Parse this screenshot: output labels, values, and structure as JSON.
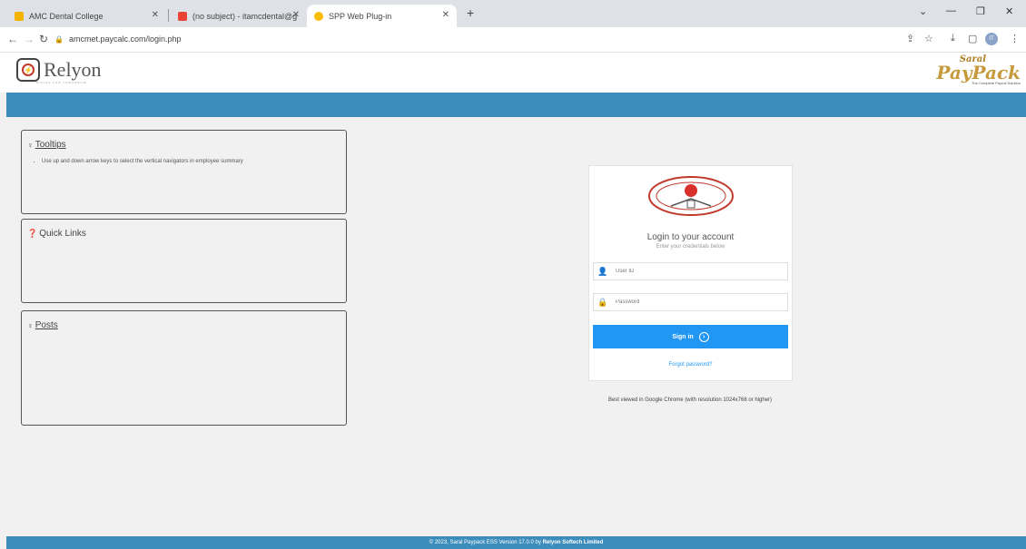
{
  "browser": {
    "tabs": [
      {
        "title": "AMC Dental College",
        "color": "#f4b400"
      },
      {
        "title": "(no subject) - itamcdental@gm",
        "color": "#ea4335"
      },
      {
        "title": "SPP Web Plug-in",
        "color": "#fbbc05"
      }
    ],
    "url": "amcmet.paycalc.com/login.php",
    "profile_initials": "IT"
  },
  "header": {
    "relyon_name": "Relyon",
    "relyon_tagline": "RISING FOR TOMORROW",
    "paypack_prefix": "Saral",
    "paypack_name": "PayPack",
    "paypack_tagline": "The Complete Payroll Solution"
  },
  "panels": {
    "tooltips": {
      "title": "Tooltips",
      "items": [
        "Use up and down arrow keys to select the vertical navigators in employee summary"
      ]
    },
    "quick_links": {
      "title": "Quick Links"
    },
    "posts": {
      "title": "Posts"
    }
  },
  "login": {
    "title": "Login to your account",
    "subtitle": "Enter your credentials below",
    "user_placeholder": "User ID",
    "password_placeholder": "Password",
    "signin_label": "Sign in",
    "forgot_label": "Forgot password?"
  },
  "best_viewed": "Best viewed in Google Chrome (with resolution 1024x768 or higher)",
  "footer": {
    "prefix": "© 2023, Saral Paypack ESS Version 17.0.0 by ",
    "company": "Relyon Softech Limited"
  },
  "colors": {
    "accent": "#3c8dbc",
    "button": "#2196f3",
    "brand_gold": "#c69a3c"
  }
}
